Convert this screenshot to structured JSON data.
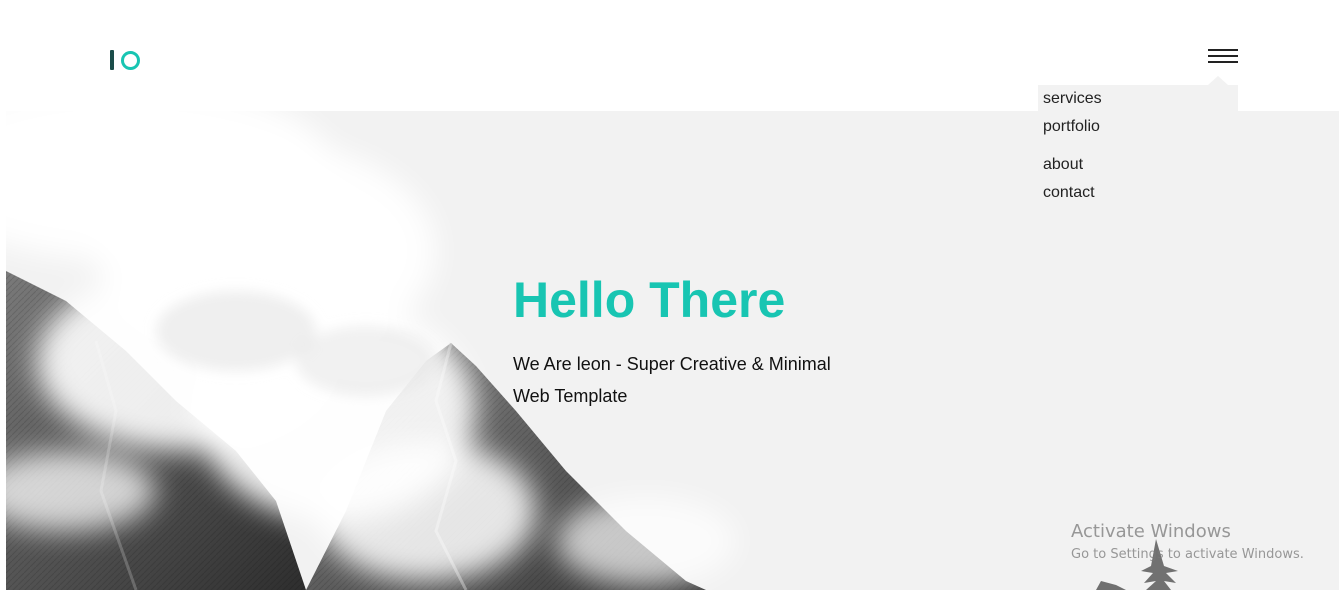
{
  "header": {
    "logo_alt": "IO",
    "menu_icon": "hamburger-menu-icon"
  },
  "menu": {
    "items": [
      {
        "label": "services"
      },
      {
        "label": "portfolio"
      },
      {
        "label": "about"
      },
      {
        "label": "contact"
      }
    ]
  },
  "hero": {
    "title": "Hello There",
    "subtitle": "We Are leon - Super Creative & Minimal Web Template",
    "background": "grayscale mountain with clouds"
  },
  "watermark": {
    "title": "Activate Windows",
    "subtitle": "Go to Settings to activate Windows."
  },
  "colors": {
    "accent": "#18c5b2",
    "logo_dark": "#1b4d4a",
    "hero_bg": "#f2f2f2",
    "text": "#111111"
  }
}
